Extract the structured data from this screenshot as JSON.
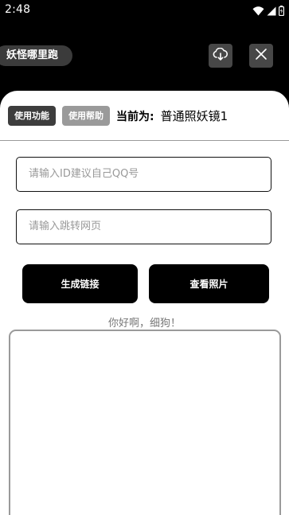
{
  "status_bar": {
    "time": "2:48",
    "icons": [
      "wifi-icon",
      "cellular-signal-icon",
      "battery-icon"
    ]
  },
  "header": {
    "app_name": "妖怪哪里跑",
    "actions": [
      "cloud-download-icon",
      "close-icon"
    ]
  },
  "tabs": {
    "use_feature": "使用功能",
    "use_help": "使用帮助"
  },
  "current": {
    "label": "当前为:",
    "value": "普通照妖镜1"
  },
  "form": {
    "id_placeholder": "请输入ID建议自己QQ号",
    "url_placeholder": "请输入跳转网页"
  },
  "buttons": {
    "generate_link": "生成链接",
    "view_photos": "查看照片"
  },
  "greeting": "你好啊，细狗！",
  "colors": {
    "background": "#000000",
    "card": "#ffffff",
    "active_tab": "#3d3d3d",
    "inactive_tab": "#9a9a9a",
    "primary_button": "#000000"
  }
}
